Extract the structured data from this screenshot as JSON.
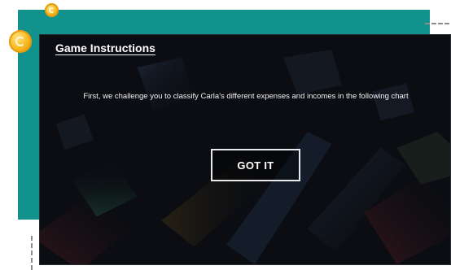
{
  "dialog": {
    "title": "Game Instructions",
    "message": "First, we challenge you to classify Carla's different expenses and incomes in the following chart",
    "button_label": "GOT IT"
  },
  "decor": {
    "icons": [
      "coin-icon",
      "coin-icon"
    ]
  },
  "colors": {
    "panel_teal": "#12928c",
    "dialog_background": "#0b0d12",
    "coin_gold": "#f7b51c",
    "text": "#ffffff"
  }
}
